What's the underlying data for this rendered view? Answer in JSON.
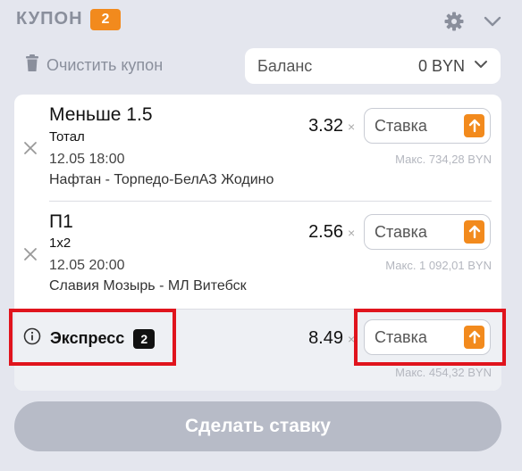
{
  "header": {
    "title": "КУПОН",
    "count": "2"
  },
  "toolbar": {
    "clear_label": "Очистить купон"
  },
  "balance": {
    "label": "Баланс",
    "value": "0 BYN"
  },
  "bets": [
    {
      "title": "Меньше 1.5",
      "subtitle": "Тотал",
      "datetime": "12.05 18:00",
      "match": "Нафтан - Торпедо-БелАЗ Жодино",
      "odds": "3.32",
      "stake_placeholder": "Ставка",
      "max": "Макс. 734,28 BYN"
    },
    {
      "title": "П1",
      "subtitle": "1х2",
      "datetime": "12.05 20:00",
      "match": "Славия Мозырь - МЛ Витебск",
      "odds": "2.56",
      "stake_placeholder": "Ставка",
      "max": "Макс. 1 092,01 BYN"
    }
  ],
  "express": {
    "label": "Экспресс",
    "count": "2",
    "odds": "8.49",
    "stake_placeholder": "Ставка",
    "max": "Макс. 454,32 BYN"
  },
  "times_symbol": "×",
  "submit_label": "Сделать ставку",
  "colors": {
    "accent": "#f28a1d",
    "highlight": "#e0141d",
    "submit_disabled": "#b7bbc7"
  },
  "icons": {
    "settings": "gear-icon",
    "collapse": "chevron-down-icon",
    "clear": "trash-icon",
    "remove": "close-icon",
    "max_stake": "arrow-up-icon",
    "info": "info-icon"
  }
}
